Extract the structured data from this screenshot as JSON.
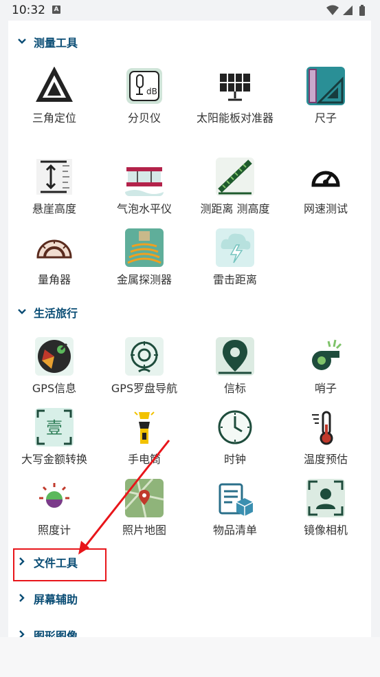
{
  "status_bar": {
    "time": "10:32",
    "notif_letter": "A"
  },
  "colors": {
    "section_title": "#0a4d75",
    "annotation": "#e8151a"
  },
  "sections": [
    {
      "title": "测量工具",
      "expanded": true,
      "tools": [
        {
          "label": "三角定位",
          "icon": "triangle-icon"
        },
        {
          "label": "分贝仪",
          "icon": "decibel-meter-icon"
        },
        {
          "label": "太阳能板对准器",
          "icon": "solar-panel-icon"
        },
        {
          "label": "尺子",
          "icon": "ruler-icon"
        },
        {
          "label": "悬崖高度",
          "icon": "cliff-height-icon"
        },
        {
          "label": "气泡水平仪",
          "icon": "bubble-level-icon"
        },
        {
          "label": "测距离 测高度",
          "icon": "distance-height-icon"
        },
        {
          "label": "网速测试",
          "icon": "speedometer-icon"
        },
        {
          "label": "量角器",
          "icon": "protractor-icon"
        },
        {
          "label": "金属探测器",
          "icon": "metal-detector-icon"
        },
        {
          "label": "雷击距离",
          "icon": "lightning-icon"
        }
      ]
    },
    {
      "title": "生活旅行",
      "expanded": true,
      "tools": [
        {
          "label": "GPS信息",
          "icon": "gps-satellite-icon"
        },
        {
          "label": "GPS罗盘导航",
          "icon": "compass-icon"
        },
        {
          "label": "信标",
          "icon": "map-pin-icon"
        },
        {
          "label": "哨子",
          "icon": "whistle-icon"
        },
        {
          "label": "大写金额转换",
          "icon": "currency-convert-icon"
        },
        {
          "label": "手电筒",
          "icon": "flashlight-icon"
        },
        {
          "label": "时钟",
          "icon": "clock-icon"
        },
        {
          "label": "温度预估",
          "icon": "thermometer-icon"
        },
        {
          "label": "照度计",
          "icon": "light-meter-icon"
        },
        {
          "label": "照片地图",
          "icon": "photo-map-icon"
        },
        {
          "label": "物品清单",
          "icon": "checklist-icon"
        },
        {
          "label": "镜像相机",
          "icon": "mirror-camera-icon"
        }
      ]
    },
    {
      "title": "文件工具",
      "expanded": false,
      "tools": []
    },
    {
      "title": "屏幕辅助",
      "expanded": false,
      "tools": []
    },
    {
      "title": "图形图像",
      "expanded": false,
      "tools": []
    }
  ]
}
